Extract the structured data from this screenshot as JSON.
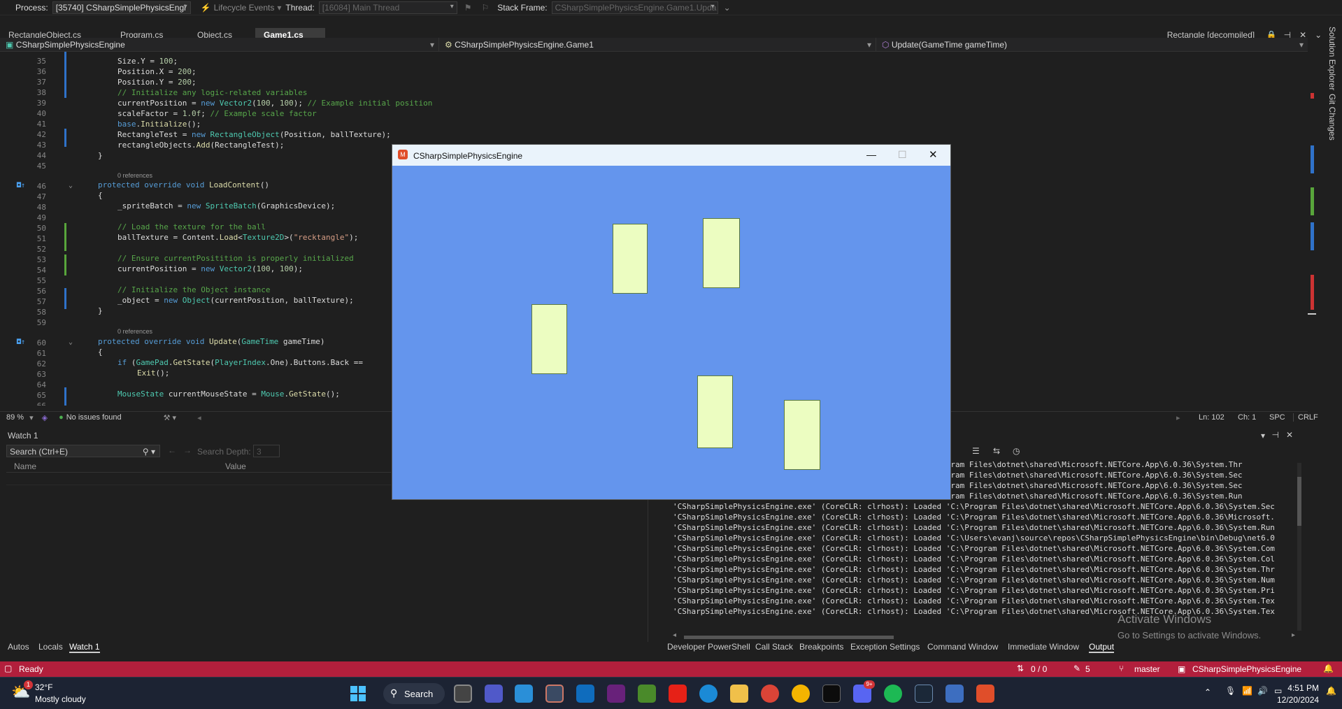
{
  "toolbar": {
    "process_label": "Process:",
    "process_value": "[35740] CSharpSimplePhysicsEngi",
    "lifecycle": "Lifecycle Events",
    "thread_label": "Thread:",
    "thread_value": "[16084] Main Thread",
    "stackframe_label": "Stack Frame:",
    "stackframe_value": "CSharpSimplePhysicsEngine.Game1.Upda"
  },
  "tabs": [
    {
      "label": "RectangleObject.cs"
    },
    {
      "label": "Program.cs"
    },
    {
      "label": "Object.cs"
    },
    {
      "label": "Game1.cs"
    }
  ],
  "decompiled_tab": "Rectangle [decompiled]",
  "nav": {
    "project": "CSharpSimplePhysicsEngine",
    "class": "CSharpSimplePhysicsEngine.Game1",
    "member": "Update(GameTime gameTime)"
  },
  "editor": {
    "references": "0 references",
    "lines": [
      "35",
      "36",
      "37",
      "38",
      "39",
      "40",
      "41",
      "42",
      "43",
      "44",
      "45",
      "46",
      "47",
      "48",
      "49",
      "50",
      "51",
      "52",
      "53",
      "54",
      "55",
      "56",
      "57",
      "58",
      "59",
      "60",
      "61",
      "62",
      "63",
      "64",
      "65",
      "66"
    ]
  },
  "status": {
    "zoom": "89 %",
    "issues": "No issues found",
    "ln": "Ln: 102",
    "ch": "Ch: 1",
    "spc": "SPC",
    "crlf": "CRLF"
  },
  "watch": {
    "title": "Watch 1",
    "search_placeholder": "Search (Ctrl+E)",
    "depth_label": "Search Depth:",
    "depth_value": "3",
    "col_name": "Name",
    "col_value": "Value"
  },
  "output_lines": [
    "Loaded 'C:\\Program Files\\dotnet\\shared\\Microsoft.NETCore.App\\6.0.36\\System.Thr",
    "Loaded 'C:\\Program Files\\dotnet\\shared\\Microsoft.NETCore.App\\6.0.36\\System.Sec",
    "Loaded 'C:\\Program Files\\dotnet\\shared\\Microsoft.NETCore.App\\6.0.36\\System.Sec",
    "Loaded 'C:\\Program Files\\dotnet\\shared\\Microsoft.NETCore.App\\6.0.36\\System.Run",
    "'CSharpSimplePhysicsEngine.exe' (CoreCLR: clrhost): Loaded 'C:\\Program Files\\dotnet\\shared\\Microsoft.NETCore.App\\6.0.36\\System.Sec",
    "'CSharpSimplePhysicsEngine.exe' (CoreCLR: clrhost): Loaded 'C:\\Program Files\\dotnet\\shared\\Microsoft.NETCore.App\\6.0.36\\Microsoft.",
    "'CSharpSimplePhysicsEngine.exe' (CoreCLR: clrhost): Loaded 'C:\\Program Files\\dotnet\\shared\\Microsoft.NETCore.App\\6.0.36\\System.Run",
    "'CSharpSimplePhysicsEngine.exe' (CoreCLR: clrhost): Loaded 'C:\\Users\\evanj\\source\\repos\\CSharpSimplePhysicsEngine\\bin\\Debug\\net6.0",
    "'CSharpSimplePhysicsEngine.exe' (CoreCLR: clrhost): Loaded 'C:\\Program Files\\dotnet\\shared\\Microsoft.NETCore.App\\6.0.36\\System.Com",
    "'CSharpSimplePhysicsEngine.exe' (CoreCLR: clrhost): Loaded 'C:\\Program Files\\dotnet\\shared\\Microsoft.NETCore.App\\6.0.36\\System.Col",
    "'CSharpSimplePhysicsEngine.exe' (CoreCLR: clrhost): Loaded 'C:\\Program Files\\dotnet\\shared\\Microsoft.NETCore.App\\6.0.36\\System.Thr",
    "'CSharpSimplePhysicsEngine.exe' (CoreCLR: clrhost): Loaded 'C:\\Program Files\\dotnet\\shared\\Microsoft.NETCore.App\\6.0.36\\System.Num",
    "'CSharpSimplePhysicsEngine.exe' (CoreCLR: clrhost): Loaded 'C:\\Program Files\\dotnet\\shared\\Microsoft.NETCore.App\\6.0.36\\System.Pri",
    "'CSharpSimplePhysicsEngine.exe' (CoreCLR: clrhost): Loaded 'C:\\Program Files\\dotnet\\shared\\Microsoft.NETCore.App\\6.0.36\\System.Tex",
    "'CSharpSimplePhysicsEngine.exe' (CoreCLR: clrhost): Loaded 'C:\\Program Files\\dotnet\\shared\\Microsoft.NETCore.App\\6.0.36\\System.Tex"
  ],
  "watermark": {
    "line1": "Activate Windows",
    "line2": "Go to Settings to activate Windows."
  },
  "bottom_tabs_left": [
    "Autos",
    "Locals",
    "Watch 1"
  ],
  "bottom_tabs_right": [
    "Developer PowerShell",
    "Call Stack",
    "Breakpoints",
    "Exception Settings",
    "Command Window",
    "Immediate Window",
    "Output"
  ],
  "vs_status": {
    "ready": "Ready",
    "updown": "0 / 0",
    "pencil": "5",
    "branch": "master",
    "repo": "CSharpSimplePhysicsEngine"
  },
  "taskbar": {
    "temp": "32°F",
    "weather": "Mostly cloudy",
    "search": "Search",
    "time": "4:51 PM",
    "date": "12/20/2024",
    "weather_badge": "1",
    "notif_badge": "9+"
  },
  "game": {
    "title": "CSharpSimplePhysicsEngine"
  },
  "right_rail": {
    "solution_explorer": "Solution Explorer",
    "git_changes": "Git Changes"
  }
}
